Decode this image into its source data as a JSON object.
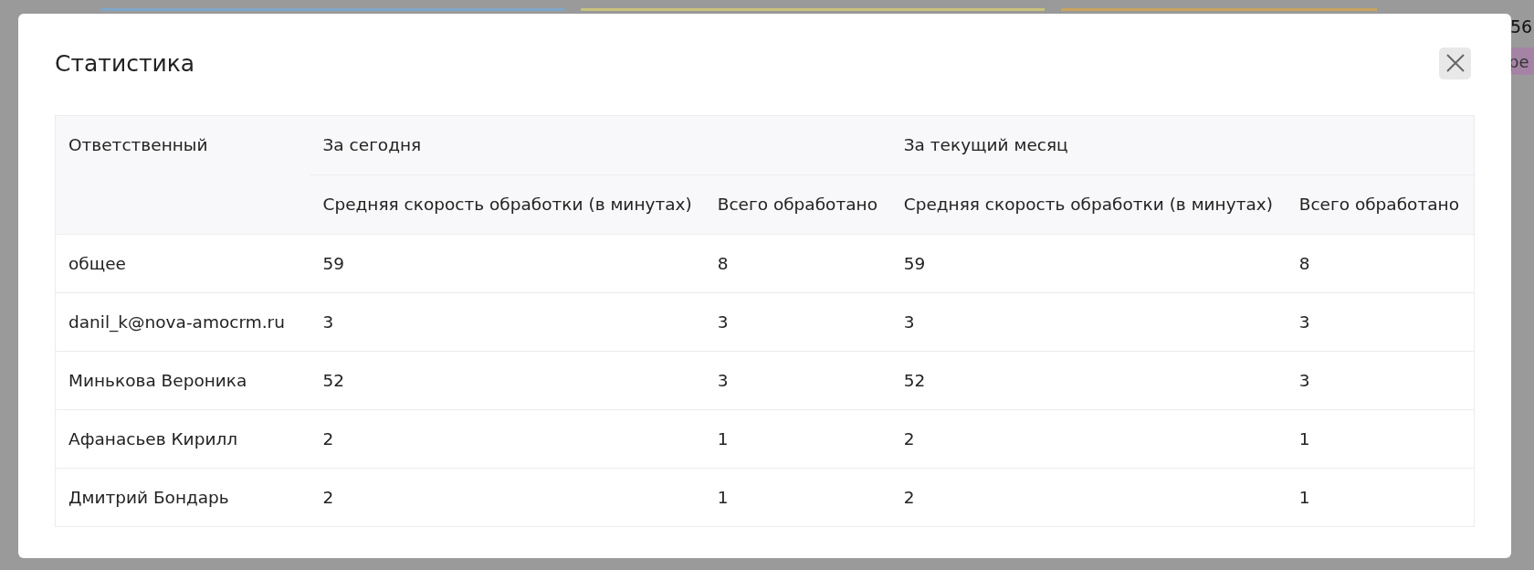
{
  "background": {
    "counter": "56",
    "tag": "ре"
  },
  "modal": {
    "title": "Статистика"
  },
  "table": {
    "group_header": {
      "responsible": "Ответственный",
      "today": "За сегодня",
      "month": "За текущий месяц"
    },
    "columns": [
      "Средняя скорость обработки (в минутах)",
      "Всего обработано",
      "Средняя скорость обработки (в минутах)",
      "Всего обработано"
    ],
    "rows": [
      {
        "name": "общее",
        "cells": [
          "59",
          "8",
          "59",
          "8"
        ]
      },
      {
        "name": "danil_k@nova-amocrm.ru",
        "cells": [
          "3",
          "3",
          "3",
          "3"
        ]
      },
      {
        "name": "Минькова Вероника",
        "cells": [
          "52",
          "3",
          "52",
          "3"
        ]
      },
      {
        "name": "Афанасьев Кирилл",
        "cells": [
          "2",
          "1",
          "2",
          "1"
        ]
      },
      {
        "name": "Дмитрий Бондарь",
        "cells": [
          "2",
          "1",
          "2",
          "1"
        ]
      }
    ]
  }
}
